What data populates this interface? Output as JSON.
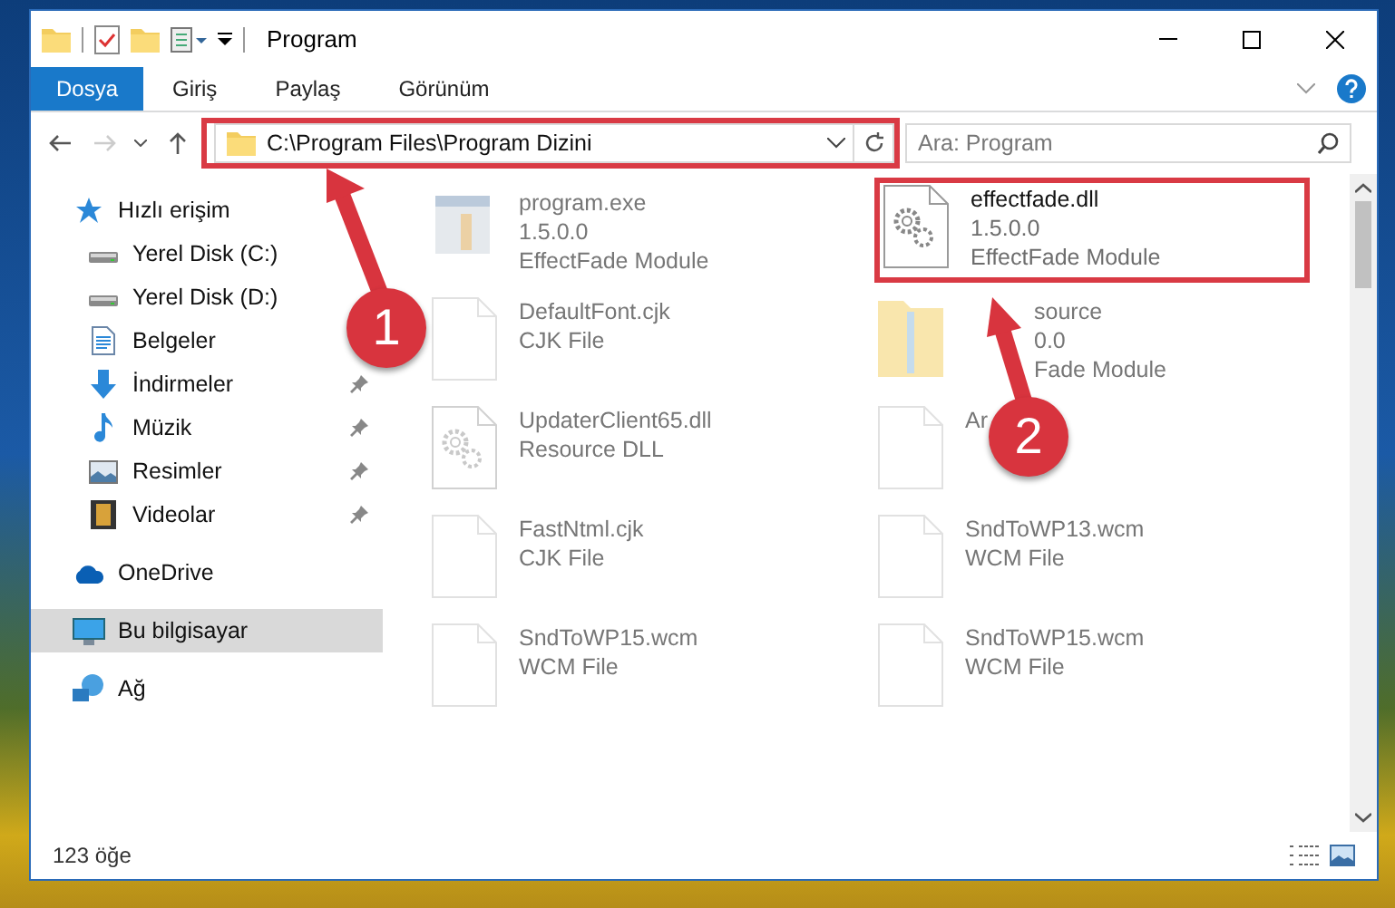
{
  "window": {
    "title": "Program"
  },
  "ribbon": {
    "tabs": [
      {
        "label": "Dosya",
        "selected": true
      },
      {
        "label": "Giriş",
        "selected": false
      },
      {
        "label": "Paylaş",
        "selected": false
      },
      {
        "label": "Görünüm",
        "selected": false
      }
    ]
  },
  "address": {
    "path": "C:\\Program Files\\Program Dizini",
    "search_placeholder": "Ara: Program",
    "highlighted": true
  },
  "sidebar": {
    "items": [
      {
        "label": "Hızlı erişim",
        "kind": "star",
        "selected": false,
        "children": [
          {
            "label": "Yerel Disk (C:)",
            "kind": "drive",
            "pinned": false,
            "selected": false
          },
          {
            "label": "Yerel Disk (D:)",
            "kind": "drive",
            "pinned": false,
            "selected": false
          },
          {
            "label": "Belgeler",
            "kind": "document",
            "pinned": false,
            "selected": false
          },
          {
            "label": "İndirmeler",
            "kind": "download",
            "pinned": true,
            "selected": false
          },
          {
            "label": "Müzik",
            "kind": "music",
            "pinned": true,
            "selected": false
          },
          {
            "label": "Resimler",
            "kind": "picture",
            "pinned": true,
            "selected": false
          },
          {
            "label": "Videolar",
            "kind": "video",
            "pinned": true,
            "selected": false
          }
        ]
      },
      {
        "label": "OneDrive",
        "kind": "cloud",
        "selected": false
      },
      {
        "label": "Bu bilgisayar",
        "kind": "computer",
        "selected": true
      },
      {
        "label": "Ağ",
        "kind": "network",
        "selected": false
      }
    ]
  },
  "files": [
    {
      "name": "program.exe",
      "details": [
        "1.5.0.0",
        "EffectFade Module"
      ],
      "kind": "exe",
      "blurred": true
    },
    {
      "name": "effectfade.dll",
      "details": [
        "1.5.0.0",
        "EffectFade Module"
      ],
      "kind": "gear",
      "blurred": false,
      "highlighted": true
    },
    {
      "name": "DefaultFont.cjk",
      "details": [
        "CJK File"
      ],
      "kind": "blank",
      "blurred": true
    },
    {
      "name": "source",
      "details": [
        "0.0",
        "Fade Module"
      ],
      "kind": "zip",
      "blurred": true,
      "covered": true
    },
    {
      "name": "UpdaterClient65.dll",
      "details": [
        "Resource DLL"
      ],
      "kind": "gear",
      "blurred": true
    },
    {
      "name": "Ar",
      "kind": "blank",
      "blurred": true
    },
    {
      "name": "FastNtml.cjk",
      "details": [
        "CJK File"
      ],
      "kind": "blank",
      "blurred": true
    },
    {
      "name": "SndToWP13.wcm",
      "details": [
        "WCM File"
      ],
      "kind": "blank",
      "blurred": true
    },
    {
      "name": "SndToWP15.wcm",
      "details": [
        "WCM File"
      ],
      "kind": "blank",
      "blurred": true
    },
    {
      "name": "SndToWP15.wcm",
      "details": [
        "WCM File"
      ],
      "kind": "blank",
      "blurred": true
    }
  ],
  "status_bar": {
    "count": "123 öğe"
  },
  "annotations": [
    {
      "number": "1"
    },
    {
      "number": "2"
    }
  ]
}
